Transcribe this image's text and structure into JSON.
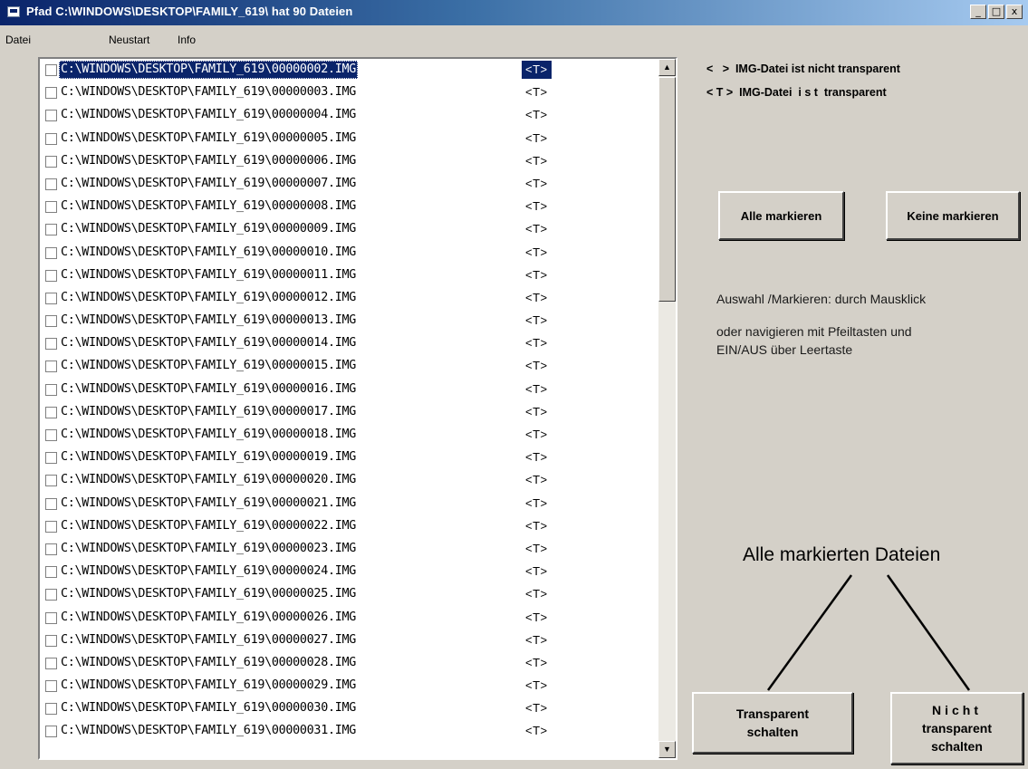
{
  "window": {
    "title": "Pfad C:\\WINDOWS\\DESKTOP\\FAMILY_619\\ hat 90 Dateien",
    "controls": [
      "_",
      "□",
      "x"
    ]
  },
  "menu": {
    "datei_label": "Datei",
    "neustart_label": "Neustart",
    "info_label": "Info"
  },
  "file_list": {
    "selected_index": 0,
    "rows": [
      {
        "path": "C:\\WINDOWS\\DESKTOP\\FAMILY_619\\00000002.IMG",
        "tag": "<T>"
      },
      {
        "path": "C:\\WINDOWS\\DESKTOP\\FAMILY_619\\00000003.IMG",
        "tag": "<T>"
      },
      {
        "path": "C:\\WINDOWS\\DESKTOP\\FAMILY_619\\00000004.IMG",
        "tag": "<T>"
      },
      {
        "path": "C:\\WINDOWS\\DESKTOP\\FAMILY_619\\00000005.IMG",
        "tag": "<T>"
      },
      {
        "path": "C:\\WINDOWS\\DESKTOP\\FAMILY_619\\00000006.IMG",
        "tag": "<T>"
      },
      {
        "path": "C:\\WINDOWS\\DESKTOP\\FAMILY_619\\00000007.IMG",
        "tag": "<T>"
      },
      {
        "path": "C:\\WINDOWS\\DESKTOP\\FAMILY_619\\00000008.IMG",
        "tag": "<T>"
      },
      {
        "path": "C:\\WINDOWS\\DESKTOP\\FAMILY_619\\00000009.IMG",
        "tag": "<T>"
      },
      {
        "path": "C:\\WINDOWS\\DESKTOP\\FAMILY_619\\00000010.IMG",
        "tag": "<T>"
      },
      {
        "path": "C:\\WINDOWS\\DESKTOP\\FAMILY_619\\00000011.IMG",
        "tag": "<T>"
      },
      {
        "path": "C:\\WINDOWS\\DESKTOP\\FAMILY_619\\00000012.IMG",
        "tag": "<T>"
      },
      {
        "path": "C:\\WINDOWS\\DESKTOP\\FAMILY_619\\00000013.IMG",
        "tag": "<T>"
      },
      {
        "path": "C:\\WINDOWS\\DESKTOP\\FAMILY_619\\00000014.IMG",
        "tag": "<T>"
      },
      {
        "path": "C:\\WINDOWS\\DESKTOP\\FAMILY_619\\00000015.IMG",
        "tag": "<T>"
      },
      {
        "path": "C:\\WINDOWS\\DESKTOP\\FAMILY_619\\00000016.IMG",
        "tag": "<T>"
      },
      {
        "path": "C:\\WINDOWS\\DESKTOP\\FAMILY_619\\00000017.IMG",
        "tag": "<T>"
      },
      {
        "path": "C:\\WINDOWS\\DESKTOP\\FAMILY_619\\00000018.IMG",
        "tag": "<T>"
      },
      {
        "path": "C:\\WINDOWS\\DESKTOP\\FAMILY_619\\00000019.IMG",
        "tag": "<T>"
      },
      {
        "path": "C:\\WINDOWS\\DESKTOP\\FAMILY_619\\00000020.IMG",
        "tag": "<T>"
      },
      {
        "path": "C:\\WINDOWS\\DESKTOP\\FAMILY_619\\00000021.IMG",
        "tag": "<T>"
      },
      {
        "path": "C:\\WINDOWS\\DESKTOP\\FAMILY_619\\00000022.IMG",
        "tag": "<T>"
      },
      {
        "path": "C:\\WINDOWS\\DESKTOP\\FAMILY_619\\00000023.IMG",
        "tag": "<T>"
      },
      {
        "path": "C:\\WINDOWS\\DESKTOP\\FAMILY_619\\00000024.IMG",
        "tag": "<T>"
      },
      {
        "path": "C:\\WINDOWS\\DESKTOP\\FAMILY_619\\00000025.IMG",
        "tag": "<T>"
      },
      {
        "path": "C:\\WINDOWS\\DESKTOP\\FAMILY_619\\00000026.IMG",
        "tag": "<T>"
      },
      {
        "path": "C:\\WINDOWS\\DESKTOP\\FAMILY_619\\00000027.IMG",
        "tag": "<T>"
      },
      {
        "path": "C:\\WINDOWS\\DESKTOP\\FAMILY_619\\00000028.IMG",
        "tag": "<T>"
      },
      {
        "path": "C:\\WINDOWS\\DESKTOP\\FAMILY_619\\00000029.IMG",
        "tag": "<T>"
      },
      {
        "path": "C:\\WINDOWS\\DESKTOP\\FAMILY_619\\00000030.IMG",
        "tag": "<T>"
      },
      {
        "path": "C:\\WINDOWS\\DESKTOP\\FAMILY_619\\00000031.IMG",
        "tag": "<T>"
      }
    ]
  },
  "legend": {
    "line1": "<   >  IMG-Datei ist nicht transparent",
    "line2": "< T >  IMG-Datei  i s t  transparent"
  },
  "buttons": {
    "alle_markieren": "Alle markieren",
    "keine_markieren": "Keine markieren",
    "transparent_schalten_line1": "Transparent",
    "transparent_schalten_line2": "schalten",
    "nicht_transparent_line1": "Nicht",
    "nicht_transparent_line2": "transparent",
    "nicht_transparent_line3": "schalten"
  },
  "info": {
    "line1": "Auswahl /Markieren: durch Mausklick",
    "line2": "oder navigieren mit Pfeiltasten und",
    "line3": "EIN/AUS über Leertaste"
  },
  "marked_files_label": "Alle markierten Dateien",
  "colors": {
    "face": "#d4d0c8",
    "selection": "#0a246a",
    "title_start": "#0a246a",
    "title_end": "#a6caf0"
  }
}
